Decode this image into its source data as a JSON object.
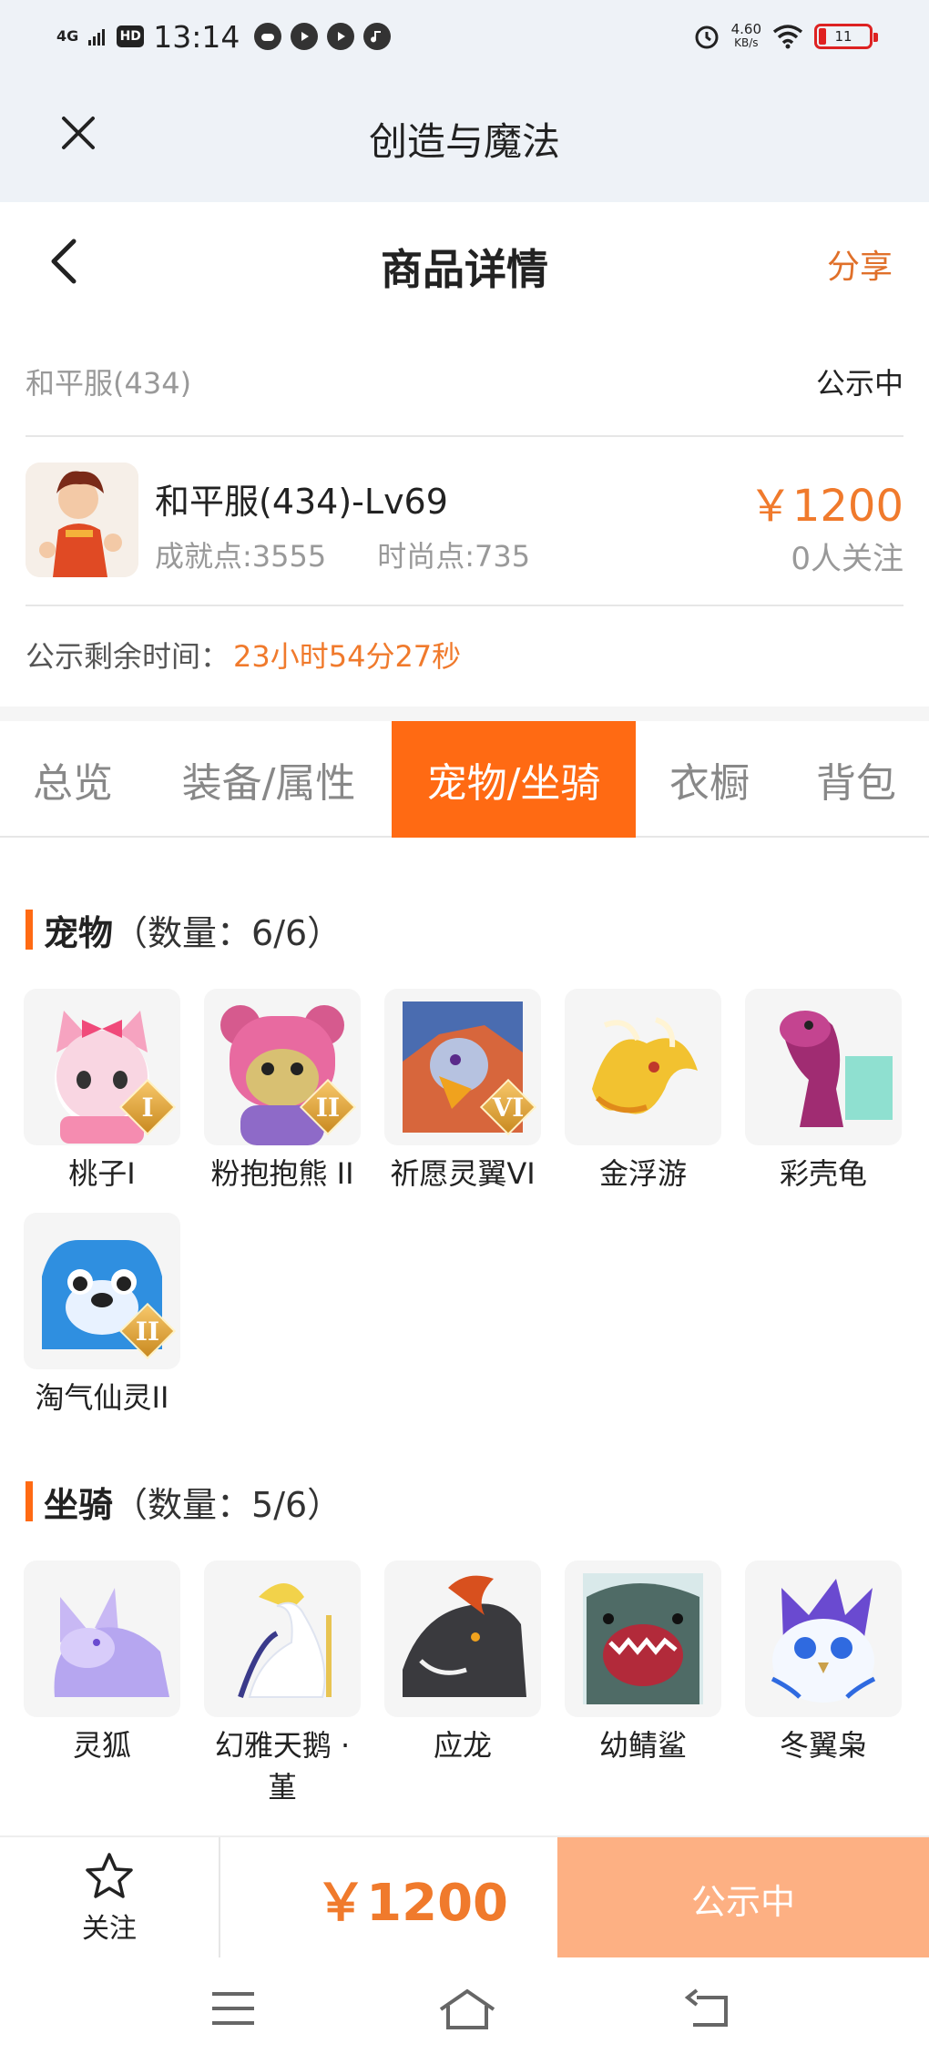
{
  "status_bar": {
    "network": "4G",
    "hd": "HD",
    "time": "13:14",
    "speed_value": "4.60",
    "speed_unit": "KB/s",
    "battery": "11",
    "icons": [
      "gamepad-icon",
      "play-icon",
      "play-icon",
      "music-icon",
      "alarm-icon",
      "wifi-icon",
      "battery-icon"
    ]
  },
  "mini_header": {
    "title": "创造与魔法",
    "close_icon": "close-icon"
  },
  "page_nav": {
    "title": "商品详情",
    "share_label": "分享",
    "back_icon": "chevron-left-icon"
  },
  "product": {
    "server": "和平服(434)",
    "status": "公示中",
    "char_name": "和平服(434)-Lv69",
    "achievement": "成就点:3555",
    "fashion": "时尚点:735",
    "price": "￥1200",
    "followers": "0人关注",
    "remaining_label": "公示剩余时间：",
    "remaining_value": "23小时54分27秒"
  },
  "tabs": [
    {
      "label": "总览",
      "active": false
    },
    {
      "label": "装备/属性",
      "active": false
    },
    {
      "label": "宠物/坐骑",
      "active": true
    },
    {
      "label": "衣橱",
      "active": false
    },
    {
      "label": "背包",
      "active": false
    }
  ],
  "pets": {
    "title": "宠物",
    "count": "（数量：6/6）",
    "items": [
      {
        "name": "桃子I",
        "badge": "I",
        "icon": "pink-cat-pet-icon"
      },
      {
        "name": "粉抱抱熊 II",
        "badge": "II",
        "icon": "pink-bear-pet-icon"
      },
      {
        "name": "祈愿灵翼VI",
        "badge": "VI",
        "icon": "eagle-pet-icon"
      },
      {
        "name": "金浮游",
        "badge": "",
        "icon": "golden-dragon-pet-icon"
      },
      {
        "name": "彩壳龟",
        "badge": "",
        "icon": "turtle-pet-icon"
      },
      {
        "name": "淘气仙灵II",
        "badge": "II",
        "icon": "blue-dog-pet-icon"
      }
    ]
  },
  "mounts": {
    "title": "坐骑",
    "count": "（数量：5/6）",
    "items": [
      {
        "name": "灵狐",
        "icon": "fox-mount-icon"
      },
      {
        "name": "幻雅天鹅 · 堇",
        "icon": "swan-mount-icon"
      },
      {
        "name": "应龙",
        "icon": "dragon-mount-icon"
      },
      {
        "name": "幼鲭鲨",
        "icon": "shark-mount-icon"
      },
      {
        "name": "冬翼枭",
        "icon": "owl-mount-icon"
      }
    ]
  },
  "bottom_bar": {
    "follow_label": "关注",
    "price": "￥1200",
    "status_button": "公示中"
  },
  "system_nav": [
    "menu-icon",
    "home-icon",
    "back-icon"
  ],
  "colors": {
    "accent": "#ff6a13",
    "price": "#f07a2c",
    "status_button": "#fdb083"
  }
}
